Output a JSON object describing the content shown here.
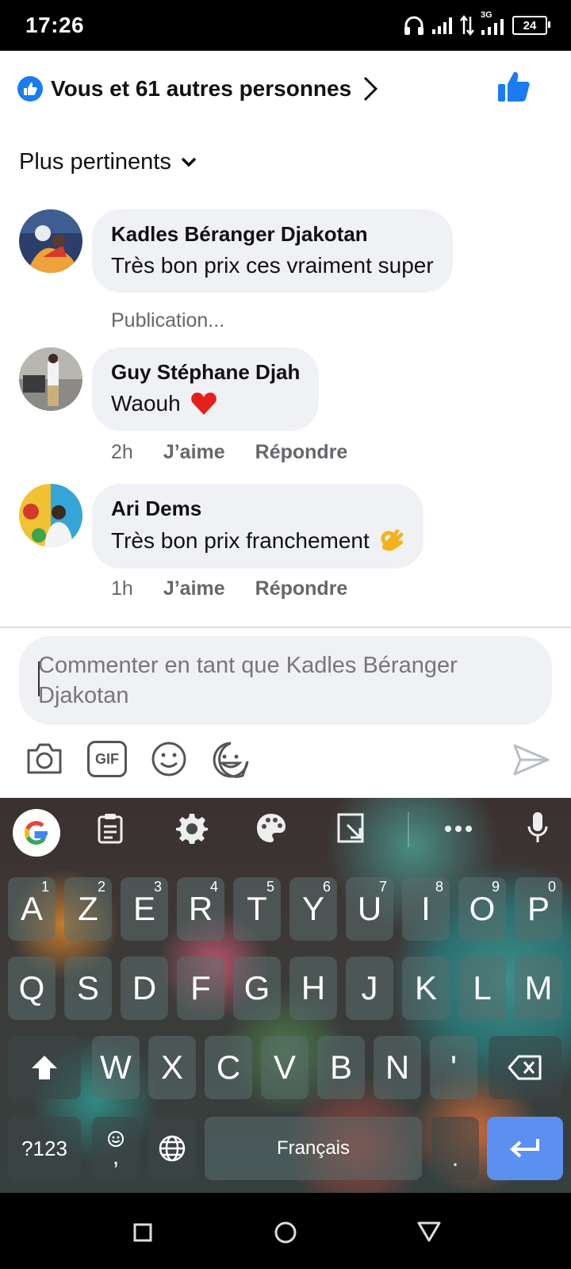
{
  "status_bar": {
    "time": "17:26",
    "network": "3G",
    "battery": "24"
  },
  "reactions": {
    "text": "Vous et 61 autres personnes"
  },
  "sort": {
    "label": "Plus pertinents"
  },
  "comments": [
    {
      "author": "Kadles Béranger Djakotan",
      "text": "Très bon prix ces vraiment super",
      "meta": "Publication..."
    },
    {
      "author": "Guy Stéphane Djah",
      "text": "Waouh",
      "time": "2h",
      "like": "J’aime",
      "reply": "Répondre"
    },
    {
      "author": "Ari Dems",
      "text": "Très bon prix franchement",
      "time": "1h",
      "like": "J’aime",
      "reply": "Répondre"
    }
  ],
  "composer": {
    "placeholder": "Commenter en tant que Kadles Béranger Djakotan"
  },
  "composer_tools": {
    "gif": "GIF"
  },
  "keyboard": {
    "row1": [
      {
        "key": "A",
        "hint": "1"
      },
      {
        "key": "Z",
        "hint": "2"
      },
      {
        "key": "E",
        "hint": "3"
      },
      {
        "key": "R",
        "hint": "4"
      },
      {
        "key": "T",
        "hint": "5"
      },
      {
        "key": "Y",
        "hint": "6"
      },
      {
        "key": "U",
        "hint": "7"
      },
      {
        "key": "I",
        "hint": "8"
      },
      {
        "key": "O",
        "hint": "9"
      },
      {
        "key": "P",
        "hint": "0"
      }
    ],
    "row2": [
      "Q",
      "S",
      "D",
      "F",
      "G",
      "H",
      "J",
      "K",
      "L",
      "M"
    ],
    "row3": [
      "W",
      "X",
      "C",
      "V",
      "B",
      "N",
      "'"
    ],
    "symbols_label": "?123",
    "comma_label": ",",
    "space_label": "Français",
    "period_label": "."
  }
}
